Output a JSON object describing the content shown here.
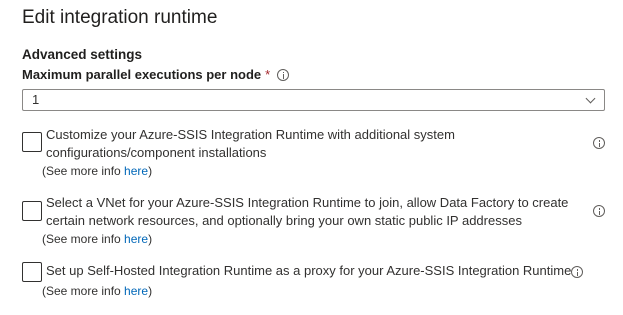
{
  "page": {
    "title": "Edit integration runtime",
    "section_title": "Advanced settings"
  },
  "parallel": {
    "label": "Maximum parallel executions per node",
    "required_mark": "*",
    "value": "1"
  },
  "options": [
    {
      "text": "Customize your Azure-SSIS Integration Runtime with additional system configurations/component installations",
      "checked": false,
      "more_prefix": "(See more info ",
      "more_link": "here",
      "more_suffix": ")"
    },
    {
      "text": "Select a VNet for your Azure-SSIS Integration Runtime to join, allow Data Factory to create certain network resources, and optionally bring your own static public IP addresses",
      "checked": false,
      "more_prefix": "(See more info ",
      "more_link": "here",
      "more_suffix": ")"
    },
    {
      "text": "Set up Self-Hosted Integration Runtime as a proxy for your Azure-SSIS Integration Runtime",
      "checked": false,
      "more_prefix": "(See more info ",
      "more_link": "here",
      "more_suffix": ")"
    }
  ],
  "colors": {
    "link": "#0067b8",
    "required": "#a4262c",
    "text": "#323130"
  }
}
